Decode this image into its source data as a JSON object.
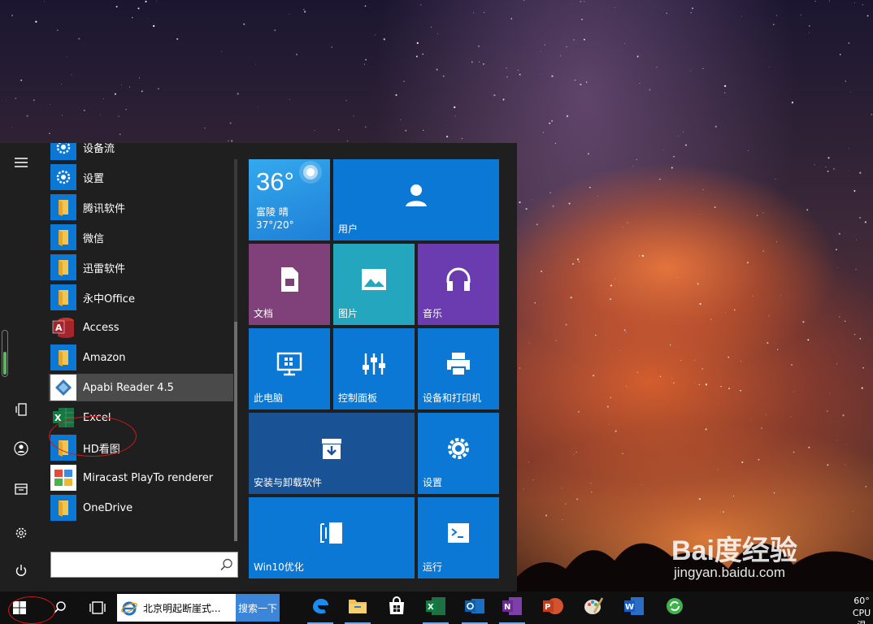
{
  "start_menu": {
    "apps": [
      {
        "label": "设备流",
        "icon": "gear-icon"
      },
      {
        "label": "设置",
        "icon": "gear-icon"
      },
      {
        "label": "腾讯软件",
        "icon": "folder-icon"
      },
      {
        "label": "微信",
        "icon": "folder-icon"
      },
      {
        "label": "迅雷软件",
        "icon": "folder-icon"
      },
      {
        "label": "永中Office",
        "icon": "folder-icon"
      },
      {
        "label": "Access",
        "icon": "access-icon"
      },
      {
        "label": "Amazon",
        "icon": "folder-icon"
      },
      {
        "label": "Apabi Reader 4.5",
        "icon": "apabi-icon"
      },
      {
        "label": "Excel",
        "icon": "excel-icon"
      },
      {
        "label": "HD看图",
        "icon": "folder-icon"
      },
      {
        "label": "Miracast PlayTo renderer",
        "icon": "miracast-icon"
      },
      {
        "label": "OneDrive",
        "icon": "folder-icon"
      }
    ],
    "selected_app": "Apabi Reader 4.5",
    "search_placeholder": "",
    "tiles": {
      "weather": {
        "temp": "36°",
        "city": "富陵  晴",
        "range": "37°/20°"
      },
      "user": "用户",
      "documents": "文档",
      "pictures": "图片",
      "music": "音乐",
      "this_pc": "此电脑",
      "control_panel": "控制面板",
      "devices_printers": "设备和打印机",
      "install_uninstall": "安装与卸载软件",
      "settings": "设置",
      "win10_optimize": "Win10优化",
      "run": "运行"
    },
    "colors": {
      "tile_blue": "#0a78d4",
      "tile_purple": "#80407a",
      "tile_teal": "#25a6bf",
      "tile_violet": "#6a3cb0",
      "tile_navy": "#1a5296",
      "annotation_red": "#d01818"
    }
  },
  "taskbar": {
    "browser_task": "北京明起断崖式...",
    "search_button": "搜索一下",
    "tray_lines": [
      "60°",
      "CPU温"
    ],
    "pinned": [
      "edge-icon",
      "explorer-icon",
      "store-icon",
      "excel-icon",
      "outlook-icon",
      "onenote-icon",
      "powerpoint-icon",
      "paint-icon",
      "word-icon",
      "refresh-app-icon"
    ]
  },
  "watermark": {
    "logo": "Bai度经验",
    "url": "jingyan.baidu.com"
  }
}
